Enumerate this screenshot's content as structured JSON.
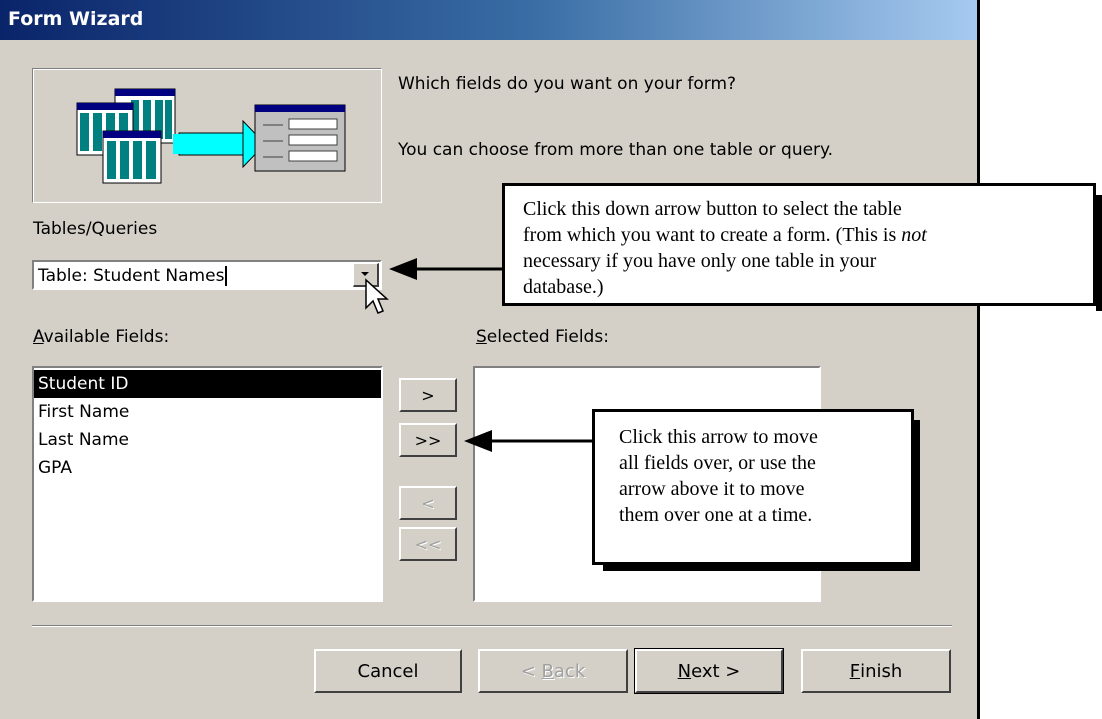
{
  "window": {
    "title": "Form Wizard"
  },
  "intro": {
    "question": "Which fields do you want on your form?",
    "hint": "You can choose from more than one table or query."
  },
  "tables_label": "Tables/Queries",
  "tables_combo": {
    "value": "Table: Student Names"
  },
  "available": {
    "label_u": "A",
    "label_rest": "vailable Fields:",
    "items": [
      "Student ID",
      "First Name",
      "Last Name",
      "GPA"
    ],
    "selected_index": 0
  },
  "selected": {
    "label_u": "S",
    "label_rest": "elected Fields:",
    "items": []
  },
  "move_buttons": {
    "add_one": ">",
    "add_all": ">>",
    "remove_one": "<",
    "remove_all": "<<"
  },
  "footer": {
    "cancel": "Cancel",
    "back_prefix": "< ",
    "back_u": "B",
    "back_rest": "ack",
    "next_u": "N",
    "next_rest": "ext >",
    "finish_u": "F",
    "finish_rest": "inish"
  },
  "callout_top": {
    "line1": "Click this down arrow button to select the table",
    "line2_a": "from which you want to create a form.  (This is ",
    "line2_em": "not",
    "line3": "necessary if you have only one table in your",
    "line4": "database.)"
  },
  "callout_mid": {
    "line1": "Click this arrow to move",
    "line2": "all fields over, or use the",
    "line3": "arrow above it to move",
    "line4": "them over one at a time."
  },
  "colors": {
    "title_gradient_start": "#0a246a",
    "title_gradient_end": "#a6caf0",
    "face": "#d4d0c8",
    "wizard_cyan": "#00ffff",
    "wizard_teal": "#008080",
    "wizard_navy": "#000080"
  }
}
